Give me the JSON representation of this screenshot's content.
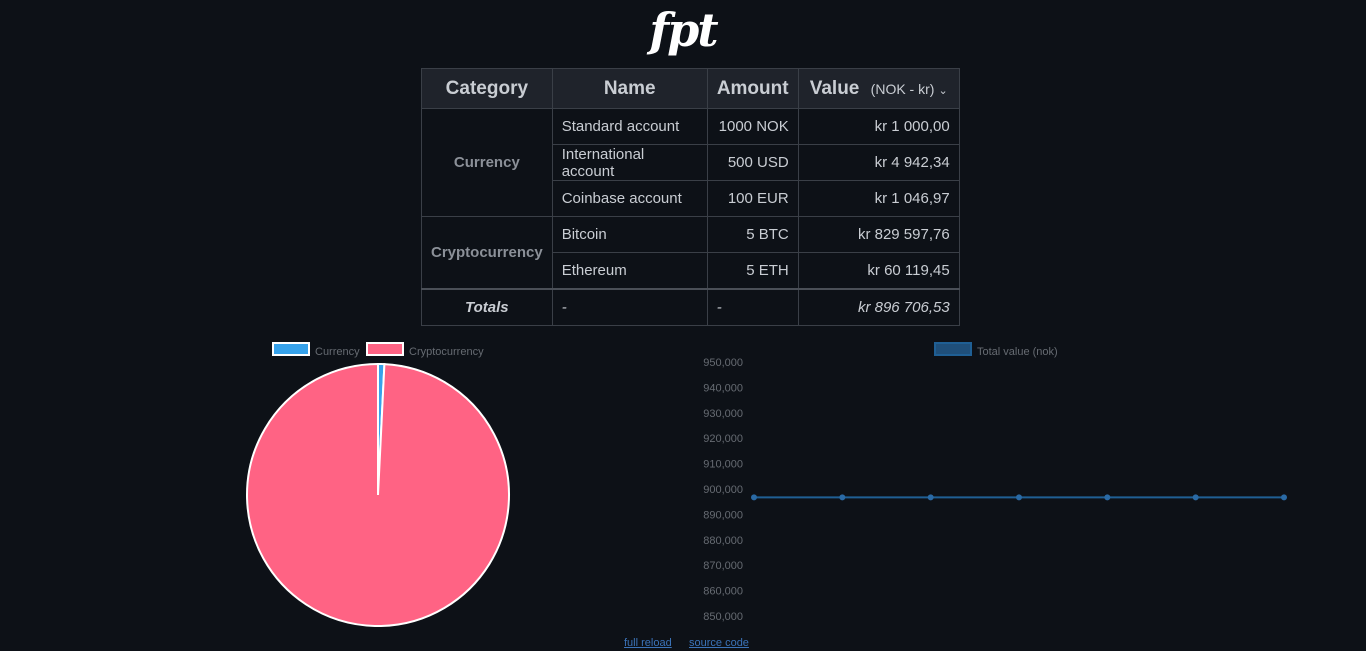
{
  "logo": "fpt",
  "table": {
    "headers": {
      "category": "Category",
      "name": "Name",
      "amount": "Amount",
      "value": "Value"
    },
    "currency_selector": "(NOK - kr)",
    "groups": [
      {
        "category": "Currency",
        "rows": [
          {
            "name": "Standard account",
            "amount": "1000 NOK",
            "value": "kr 1 000,00"
          },
          {
            "name": "International account",
            "amount": "500 USD",
            "value": "kr 4 942,34"
          },
          {
            "name": "Coinbase account",
            "amount": "100 EUR",
            "value": "kr 1 046,97"
          }
        ]
      },
      {
        "category": "Cryptocurrency",
        "rows": [
          {
            "name": "Bitcoin",
            "amount": "5 BTC",
            "value": "kr 829 597,76"
          },
          {
            "name": "Ethereum",
            "amount": "5 ETH",
            "value": "kr 60 119,45"
          }
        ]
      }
    ],
    "totals": {
      "label": "Totals",
      "name": "-",
      "amount": "-",
      "value": "kr 896 706,53"
    }
  },
  "colors": {
    "currency": "#36a2eb",
    "cryptocurrency": "#ff6384",
    "line": "#1f5f94"
  },
  "footer": {
    "reload": "full reload",
    "source": "source code"
  },
  "chart_data": [
    {
      "type": "pie",
      "categories": [
        "Currency",
        "Cryptocurrency"
      ],
      "values": [
        6989.31,
        889717.21
      ],
      "legend": "top"
    },
    {
      "type": "line",
      "series": [
        {
          "name": "Total value (nok)",
          "values": [
            896706.53,
            896706.53,
            896706.53,
            896706.53,
            896706.53,
            896706.53,
            896706.53
          ]
        }
      ],
      "yticks": [
        "950,000",
        "940,000",
        "930,000",
        "920,000",
        "910,000",
        "900,000",
        "890,000",
        "880,000",
        "870,000",
        "860,000",
        "850,000"
      ],
      "ylim": [
        850000,
        950000
      ],
      "legend": "top"
    }
  ]
}
